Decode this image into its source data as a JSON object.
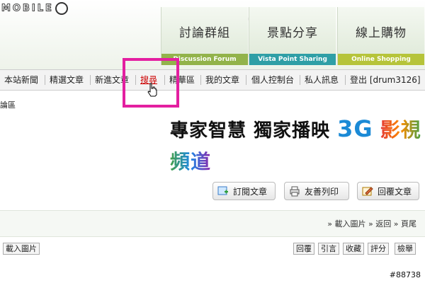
{
  "logo_text": "MOBILE",
  "top_tabs": [
    {
      "cn": "討論群組",
      "en": "Discussion Forum"
    },
    {
      "cn": "景點分享",
      "en": "Vista Point Sharing"
    },
    {
      "cn": "線上購物",
      "en": "Online Shopping"
    }
  ],
  "nav": {
    "items": [
      "本站新聞",
      "精選文章",
      "新進文章",
      "搜尋",
      "精華區",
      "我的文章",
      "個人控制台",
      "私人訊息",
      "登出 [drum3126]"
    ]
  },
  "breadcrumb": "論區",
  "banner": {
    "text1": "專家智慧 獨家播映",
    "g3": "3G",
    "tv": "影視頻道"
  },
  "actions": {
    "subscribe": "訂閱文章",
    "print": "友善列印",
    "reply": "回覆文章"
  },
  "panel": {
    "load_images": "» 載入圖片",
    "back": "» 返回",
    "bottom": "» 頁尾"
  },
  "post": {
    "load_images_btn": "載入圖片",
    "reply": "回覆",
    "quote": "引言",
    "fav": "收藏",
    "rate": "評分",
    "report": "檢舉",
    "id": "#88738"
  }
}
